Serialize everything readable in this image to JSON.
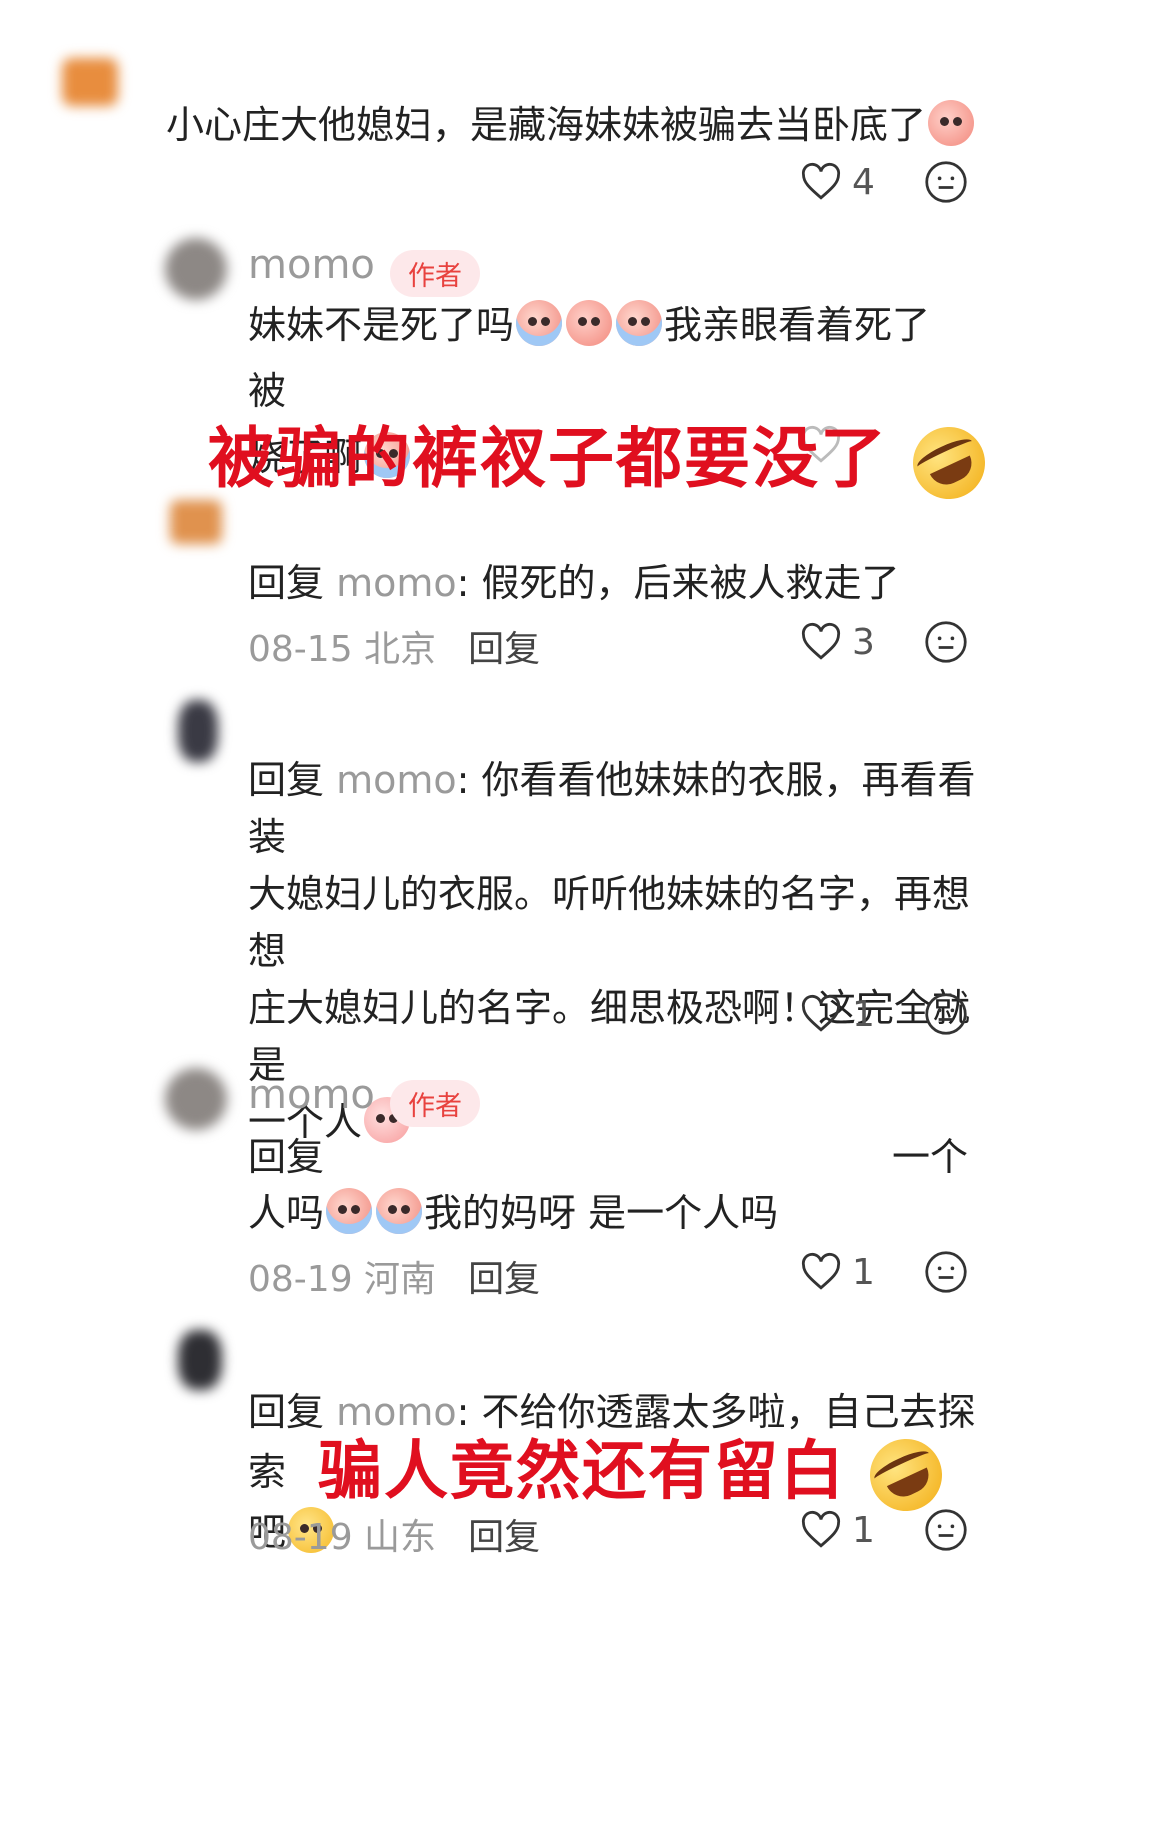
{
  "c1": {
    "text": "小心庄大他媳妇，是藏海妹妹被骗去当卧底了",
    "likes": "4"
  },
  "r1": {
    "name": "momo",
    "tag": "作者",
    "line1": "妹妹不是死了吗",
    "line1b": "我亲眼看着死了 被",
    "line2": "烧了啊"
  },
  "overlay1": "被骗的裤衩子都要没了",
  "r2": {
    "prefix": "回复 ",
    "mention": "momo",
    "text": ": 假死的，后来被人救走了",
    "date": "08-15 北京",
    "reply": "回复",
    "likes": "3"
  },
  "r3": {
    "prefix": "回复 ",
    "mention": "momo",
    "line1": ": 你看看他妹妹的衣服，再看看装",
    "line2": "大媳妇儿的衣服。听听他妹妹的名字，再想想",
    "line3": "庄大媳妇儿的名字。细思极恐啊！这完全就是",
    "line4": "一个人",
    "likes": "1"
  },
  "r4": {
    "name": "momo",
    "tag": "作者",
    "line1a": "回复",
    "line1b": "一个",
    "line2a": "人吗",
    "line2b": "我的妈呀 是一个人吗",
    "date": "08-19 河南",
    "reply": "回复",
    "likes": "1"
  },
  "r5": {
    "prefix": "回复 ",
    "mention": "momo",
    "line1": ": 不给你透露太多啦，自己去探索",
    "line2": "吧",
    "date": "08-19 山东",
    "reply": "回复",
    "likes": "1"
  },
  "overlay2": "骗人竟然还有留白",
  "colors": {
    "overlay": "#e00f1f",
    "tag_bg": "#fde8ea",
    "tag_text": "#e8423f"
  }
}
